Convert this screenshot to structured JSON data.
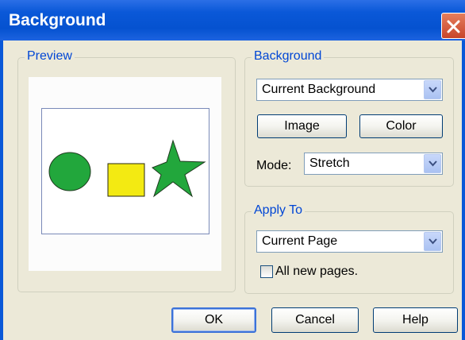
{
  "window": {
    "title": "Background",
    "close_icon": "close-icon"
  },
  "preview": {
    "legend": "Preview",
    "shapes": [
      "circle",
      "square",
      "star"
    ],
    "colors": {
      "circle": "#22a73c",
      "square": "#f3ea12",
      "star": "#22a73c"
    }
  },
  "background": {
    "legend": "Background",
    "select_value": "Current Background",
    "image_button": "Image",
    "color_button": "Color",
    "mode_label": "Mode:",
    "mode_value": "Stretch"
  },
  "apply_to": {
    "legend": "Apply To",
    "select_value": "Current Page",
    "checkbox_label": "All new pages.",
    "checked": false
  },
  "buttons": {
    "ok": "OK",
    "cancel": "Cancel",
    "help": "Help"
  },
  "theme": {
    "title_bar": "#0a58d8",
    "dialog_bg": "#ece9d8",
    "group_label": "#0046d5"
  }
}
